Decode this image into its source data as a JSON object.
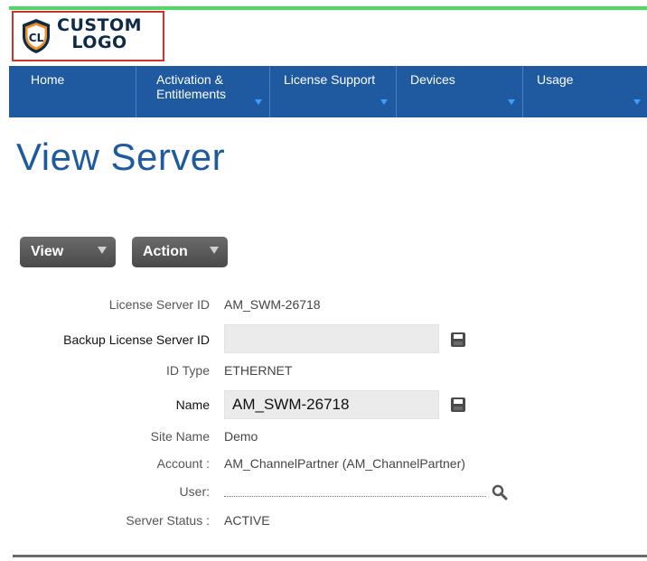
{
  "logo": {
    "line1": "CUSTOM",
    "line2": "LOGO"
  },
  "nav": {
    "items": [
      {
        "line1": "Home",
        "line2": ""
      },
      {
        "line1": "Activation &",
        "line2": "Entitlements"
      },
      {
        "line1": "License Support",
        "line2": ""
      },
      {
        "line1": "Devices",
        "line2": ""
      },
      {
        "line1": "Usage",
        "line2": ""
      }
    ]
  },
  "page": {
    "title": "View Server"
  },
  "toolbar": {
    "view_label": "View",
    "action_label": "Action"
  },
  "details": {
    "license_server_id_label": "License Server ID",
    "license_server_id_value": "AM_SWM-26718",
    "backup_label": "Backup License Server ID",
    "backup_value": "",
    "id_type_label": "ID Type",
    "id_type_value": "ETHERNET",
    "name_label": "Name",
    "name_value": "AM_SWM-26718",
    "site_name_label": "Site Name",
    "site_name_value": "Demo",
    "account_label": "Account :",
    "account_value": "AM_ChannelPartner (AM_ChannelPartner)",
    "user_label": "User:",
    "user_value": "",
    "status_label": "Server Status :",
    "status_value": "ACTIVE"
  },
  "colors": {
    "nav_bg": "#1f5aa0",
    "title": "#1f5aa0",
    "top_bar": "#4cd964",
    "logo_border": "#d0312d"
  },
  "icons": {
    "save": "floppy-disk-icon",
    "search": "magnifier-icon",
    "dropdown": "caret-down-icon"
  }
}
